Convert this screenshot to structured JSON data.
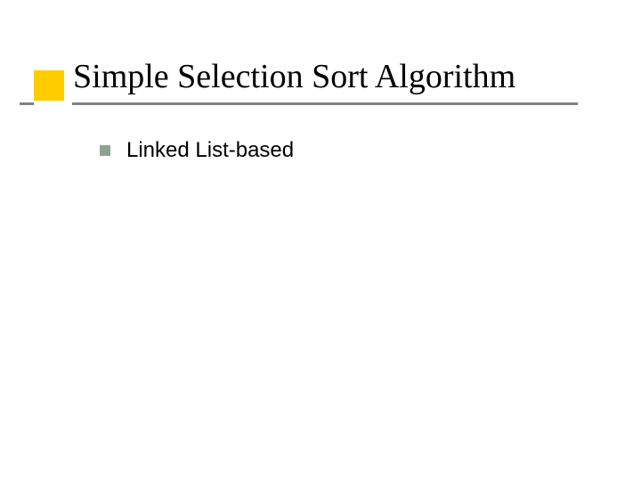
{
  "slide": {
    "title": "Simple Selection Sort Algorithm",
    "bullets": [
      {
        "text": "Linked List-based"
      }
    ]
  },
  "colors": {
    "accent_square": "#ffcc00",
    "underline": "#808080",
    "bullet_square": "#8ea38e"
  }
}
